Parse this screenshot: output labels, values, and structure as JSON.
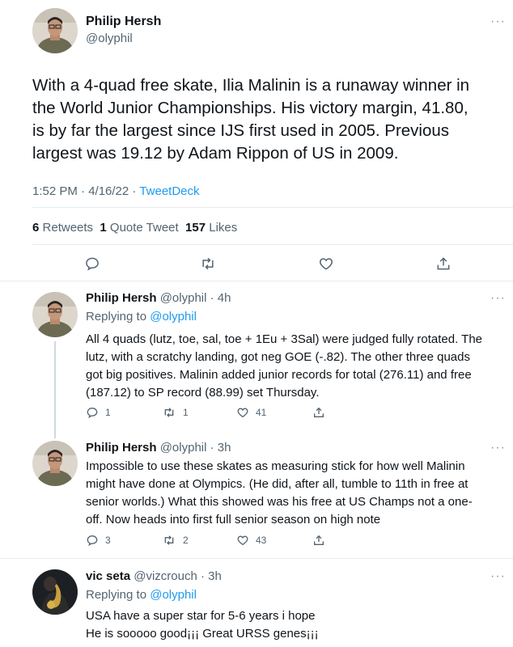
{
  "main_tweet": {
    "display_name": "Philip Hersh",
    "handle": "@olyphil",
    "text_lines": [
      "With a 4-quad free skate, Ilia Malinin is a runaway winner in",
      "the World Junior Championships.  His victory margin, 41.80,",
      "is by far the largest since IJS first used in 2005.  Previous",
      "largest was 19.12 by Adam Rippon of US in 2009."
    ],
    "timestamp": "1:52 PM · 4/16/22 · ",
    "source": "TweetDeck",
    "stats": {
      "retweets_count": "6",
      "retweets_label": "Retweets",
      "quotes_count": "1",
      "quotes_label": "Quote Tweet",
      "likes_count": "157",
      "likes_label": "Likes"
    }
  },
  "replies": [
    {
      "display_name": "Philip Hersh",
      "meta": "@olyphil · 4h",
      "replying_prefix": "Replying to ",
      "replying_to": "@olyphil",
      "text_lines": [
        "All 4 quads (lutz, toe, sal, toe + 1Eu + 3Sal) were judged fully rotated.  The",
        "lutz, with a scratchy landing, got neg GOE (-.82).  The other three quads",
        "got big positives.  Malinin added junior records for total (276.11) and free",
        "(187.12) to SP record (88.99) set Thursday."
      ],
      "reply_count": "1",
      "retweet_count": "1",
      "like_count": "41"
    },
    {
      "display_name": "Philip Hersh",
      "meta": "@olyphil · 3h",
      "text_lines": [
        "Impossible to use these skates as  measuring stick for how well Malinin",
        "might have done at Olympics.  (He did, after all, tumble to 11th in free at",
        "senior worlds.)  What this showed was his free at US Champs not a one-",
        "off.  Now heads into first full senior season on high note"
      ],
      "reply_count": "3",
      "retweet_count": "2",
      "like_count": "43"
    },
    {
      "display_name": "vic seta",
      "meta": "@vizcrouch · 3h",
      "replying_prefix": "Replying to ",
      "replying_to": "@olyphil",
      "text_lines": [
        "USA have a super star for 5-6 years i hope",
        "He is sooooo good¡¡¡ Great URSS genes¡¡¡"
      ]
    }
  ],
  "more_glyph": "···",
  "colors": {
    "accent": "#1d9bf0",
    "secondary_text": "#536471",
    "divider": "#e6ecf0"
  },
  "icons": [
    "avatar-philip",
    "avatar-vic",
    "reply-icon",
    "retweet-icon",
    "like-icon",
    "share-icon",
    "more-icon"
  ]
}
